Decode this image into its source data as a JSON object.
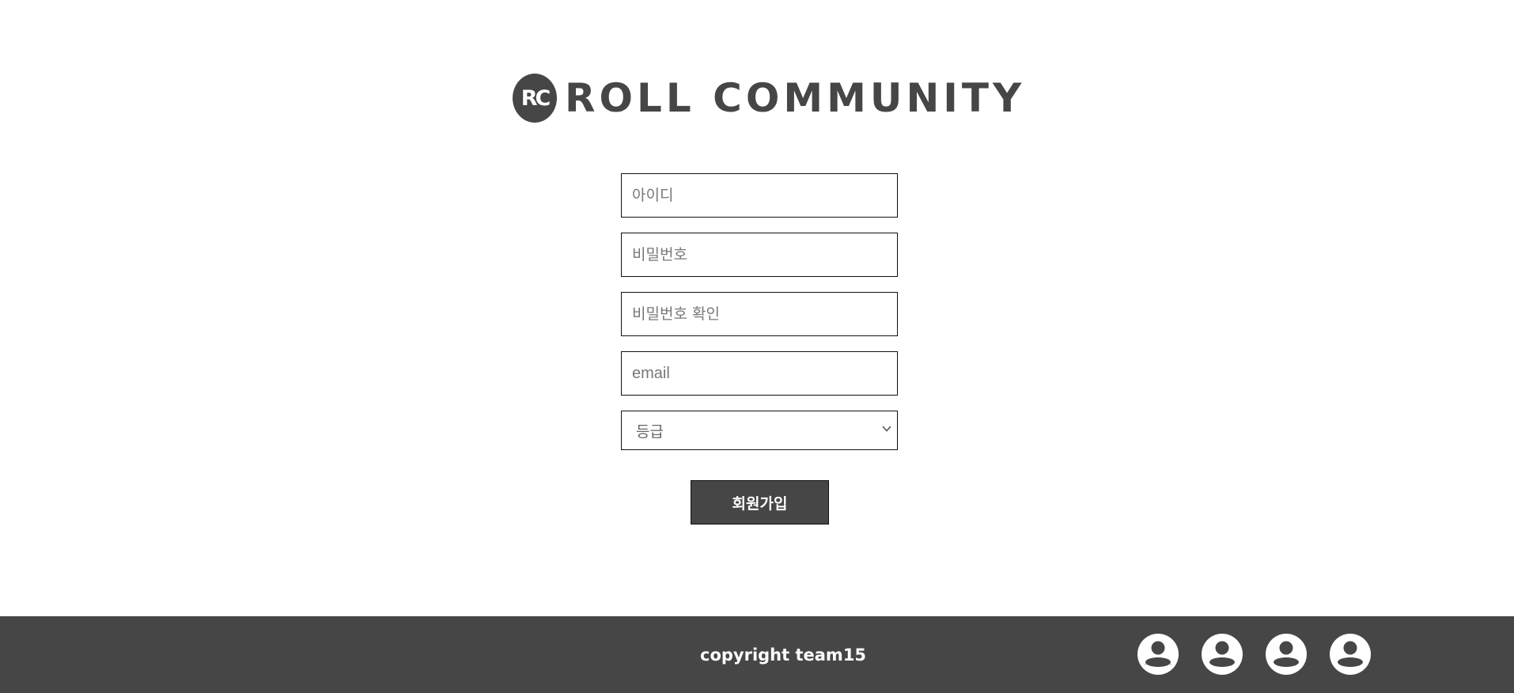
{
  "logo": {
    "badge": "RC",
    "text": "ROLL COMMUNITY"
  },
  "form": {
    "id_placeholder": "아이디",
    "password_placeholder": "비밀번호",
    "password_confirm_placeholder": "비밀번호 확인",
    "email_placeholder": "email",
    "grade_selected": "등급",
    "submit_label": "회원가입"
  },
  "footer": {
    "copyright": "copyright team15",
    "member_icons": [
      "user-icon",
      "user-icon",
      "user-icon",
      "user-icon"
    ]
  },
  "colors": {
    "primary": "#464646",
    "background": "#ffffff",
    "footer_text": "#ffffff"
  }
}
